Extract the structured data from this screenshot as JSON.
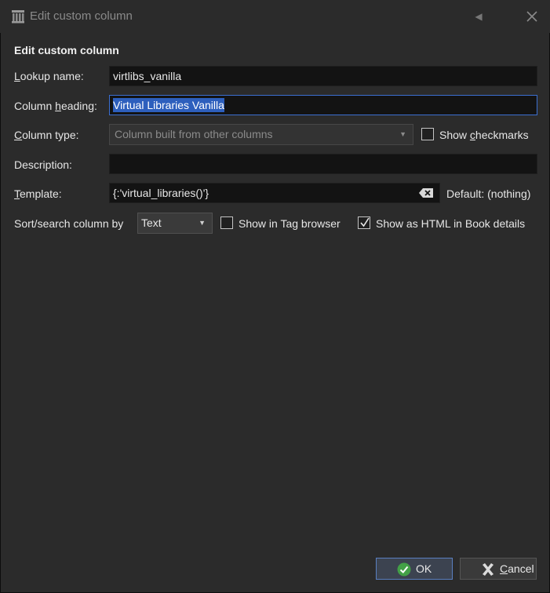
{
  "window": {
    "title": "Edit custom column",
    "icon": "library-column-icon",
    "arrow_glyph": "◀",
    "close_icon": "close-icon"
  },
  "form": {
    "heading": "Edit custom column",
    "lookup": {
      "label_pre": "",
      "label_u": "L",
      "label_post": "ookup name:",
      "value": "virtlibs_vanilla"
    },
    "heading_field": {
      "label_pre": "Column ",
      "label_u": "h",
      "label_post": "eading:",
      "value": "Virtual Libraries Vanilla"
    },
    "column_type": {
      "label_pre": "",
      "label_u": "C",
      "label_post": "olumn type:",
      "value": "Column built from other columns",
      "disabled": true
    },
    "show_checkmarks": {
      "label_pre": "Show ",
      "label_u": "c",
      "label_post": "heckmarks",
      "checked": false
    },
    "description": {
      "label": "Description:",
      "value": ""
    },
    "template": {
      "label_pre": "",
      "label_u": "T",
      "label_post": "emplate:",
      "value": "{:'virtual_libraries()'}",
      "default_text": "Default: (nothing)"
    },
    "sort": {
      "label": "Sort/search column by",
      "value": "Text"
    },
    "show_in_tag_browser": {
      "label": "Show in Tag browser",
      "checked": false
    },
    "show_as_html": {
      "label": "Show as HTML in Book details",
      "checked": true
    }
  },
  "buttons": {
    "ok": {
      "label": "OK",
      "icon": "check-circle-icon",
      "accent": "#43a047"
    },
    "cancel": {
      "label_pre": "",
      "label_u": "C",
      "label_post": "ancel",
      "icon": "x-icon"
    }
  },
  "colors": {
    "background": "#2b2b2b",
    "field": "#131313",
    "selection": "#2d5fbd"
  }
}
